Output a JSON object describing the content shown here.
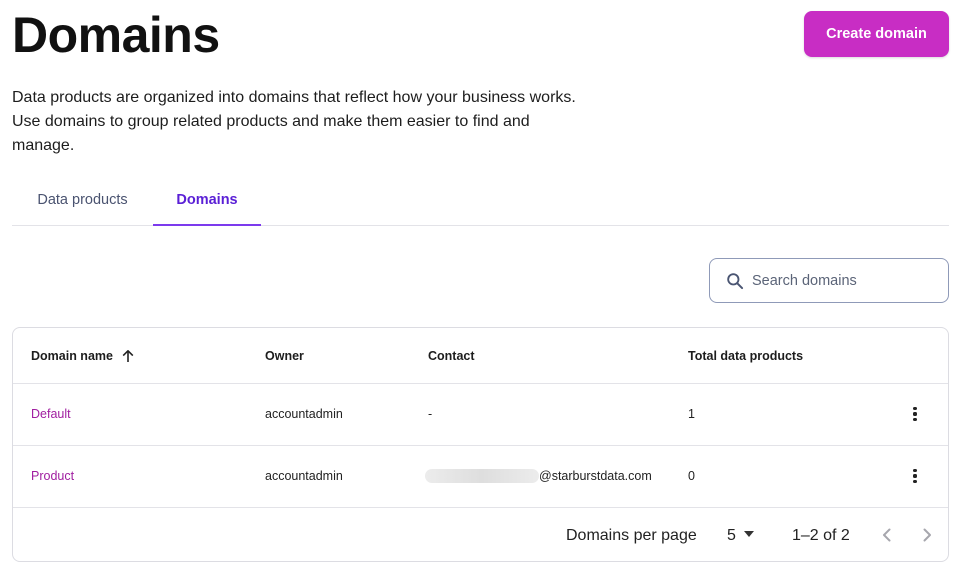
{
  "page": {
    "title": "Domains",
    "create_button_label": "Create domain",
    "description": "Data products are organized into domains that reflect how your business works. Use domains to group related products and make them easier to find and manage."
  },
  "tabs": [
    {
      "label": "Data products",
      "active": false
    },
    {
      "label": "Domains",
      "active": true
    }
  ],
  "search": {
    "placeholder": "Search domains",
    "value": ""
  },
  "table": {
    "columns": {
      "domain_name": "Domain name",
      "owner": "Owner",
      "contact": "Contact",
      "total": "Total data products"
    },
    "sort": {
      "column": "Domain name",
      "direction": "ascending",
      "icon": "arrow-up-icon"
    },
    "rows": [
      {
        "domain_name": "Default",
        "owner": "accountadmin",
        "contact": "-",
        "total": "1"
      },
      {
        "domain_name": "Product",
        "owner": "accountadmin",
        "contact": "@starburstdata.com",
        "total": "0"
      }
    ]
  },
  "pagination": {
    "per_page_label": "Domains per page",
    "per_page_value": "5",
    "range_text": "1–2 of 2"
  },
  "colors": {
    "brand_button": "#c82dc4",
    "active_tab": "#7c3aed",
    "link": "#a01ea0"
  }
}
